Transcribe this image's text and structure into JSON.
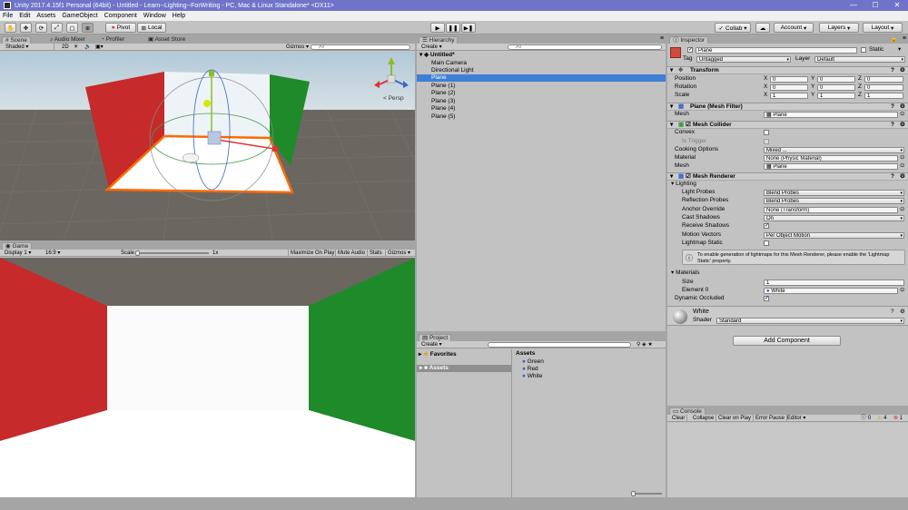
{
  "window": {
    "title": "Unity 2017.4.15f1 Personal (64bit) - Untitled - Learn--Lighting--ForWriting - PC, Mac & Linux Standalone* <DX11>",
    "minimize": "—",
    "maximize": "☐",
    "close": "✕"
  },
  "menu": [
    "File",
    "Edit",
    "Assets",
    "GameObject",
    "Component",
    "Window",
    "Help"
  ],
  "toolbar": {
    "pivot": "Pivot",
    "local": "Local",
    "collab": "Collab ▾",
    "account": "Account",
    "layers": "Layers",
    "layout": "Layout"
  },
  "scene": {
    "tabs": [
      "Scene",
      "Audio Mixer",
      "Profiler",
      "Asset Store"
    ],
    "shading": "Shaded",
    "mode2d": "2D",
    "gizmos": "Gizmos",
    "search": "All",
    "persp": "< Persp",
    "colors": {
      "red": "#c62a2a",
      "green": "#1f8a29",
      "sky": "#8fb6cc",
      "ground": "#6b6760"
    }
  },
  "game": {
    "tab": "Game",
    "display": "Display 1",
    "aspect": "16:9",
    "scale_label": "Scale",
    "scale_value": "1x",
    "maximize": "Maximize On Play",
    "mute": "Mute Audio",
    "stats": "Stats",
    "gizmos": "Gizmos"
  },
  "hierarchy": {
    "tab": "Hierarchy",
    "create": "Create",
    "search": "All",
    "scene": "Untitled*",
    "items": [
      "Main Camera",
      "Directional Light",
      "Plane",
      "Plane (1)",
      "Plane (2)",
      "Plane (3)",
      "Plane (4)",
      "Plane (5)"
    ],
    "selected": "Plane"
  },
  "project": {
    "tab": "Project",
    "create": "Create",
    "favorites": "Favorites",
    "assets_folder": "Assets",
    "assets_header": "Assets",
    "assets": [
      "Green",
      "Red",
      "White"
    ]
  },
  "inspector": {
    "tab": "Inspector",
    "object_name": "Plane",
    "static": "Static",
    "tag_label": "Tag",
    "tag_value": "Untagged",
    "layer_label": "Layer",
    "layer_value": "Default",
    "transform": {
      "title": "Transform",
      "position": [
        "0",
        "0",
        "0"
      ],
      "rotation": [
        "0",
        "0",
        "0"
      ],
      "scale": [
        "1",
        "1",
        "1"
      ],
      "labels": {
        "position": "Position",
        "rotation": "Rotation",
        "scale": "Scale",
        "x": "X",
        "y": "Y",
        "z": "Z"
      }
    },
    "mesh_filter": {
      "title": "Plane (Mesh Filter)",
      "mesh_label": "Mesh",
      "mesh_value": "Plane"
    },
    "mesh_collider": {
      "title": "Mesh Collider",
      "convex": "Convex",
      "is_trigger": "Is Trigger",
      "cooking": "Cooking Options",
      "cooking_value": "Mixed ...",
      "material": "Material",
      "material_value": "None (Physic Material)",
      "mesh": "Mesh",
      "mesh_value": "Plane"
    },
    "mesh_renderer": {
      "title": "Mesh Renderer",
      "lighting": "Lighting",
      "light_probes": "Light Probes",
      "light_probes_value": "Blend Probes",
      "reflection_probes": "Reflection Probes",
      "reflection_probes_value": "Blend Probes",
      "anchor": "Anchor Override",
      "anchor_value": "None (Transform)",
      "cast_shadows": "Cast Shadows",
      "cast_shadows_value": "On",
      "receive_shadows": "Receive Shadows",
      "motion_vectors": "Motion Vectors",
      "motion_vectors_value": "Per Object Motion",
      "lightmap_static": "Lightmap Static",
      "info": "To enable generation of lightmaps for this Mesh Renderer, please enable the 'Lightmap Static' property.",
      "materials": "Materials",
      "size": "Size",
      "size_value": "1",
      "element0": "Element 0",
      "element0_value": "White",
      "dynamic_occluded": "Dynamic Occluded"
    },
    "material": {
      "name": "White",
      "shader_label": "Shader",
      "shader_value": "Standard"
    },
    "add_component": "Add Component"
  },
  "console": {
    "tab": "Console",
    "clear": "Clear",
    "collapse": "Collapse",
    "clear_on_play": "Clear on Play",
    "error_pause": "Error Pause",
    "editor": "Editor",
    "logs": "0",
    "warnings": "4",
    "errors": "1"
  }
}
